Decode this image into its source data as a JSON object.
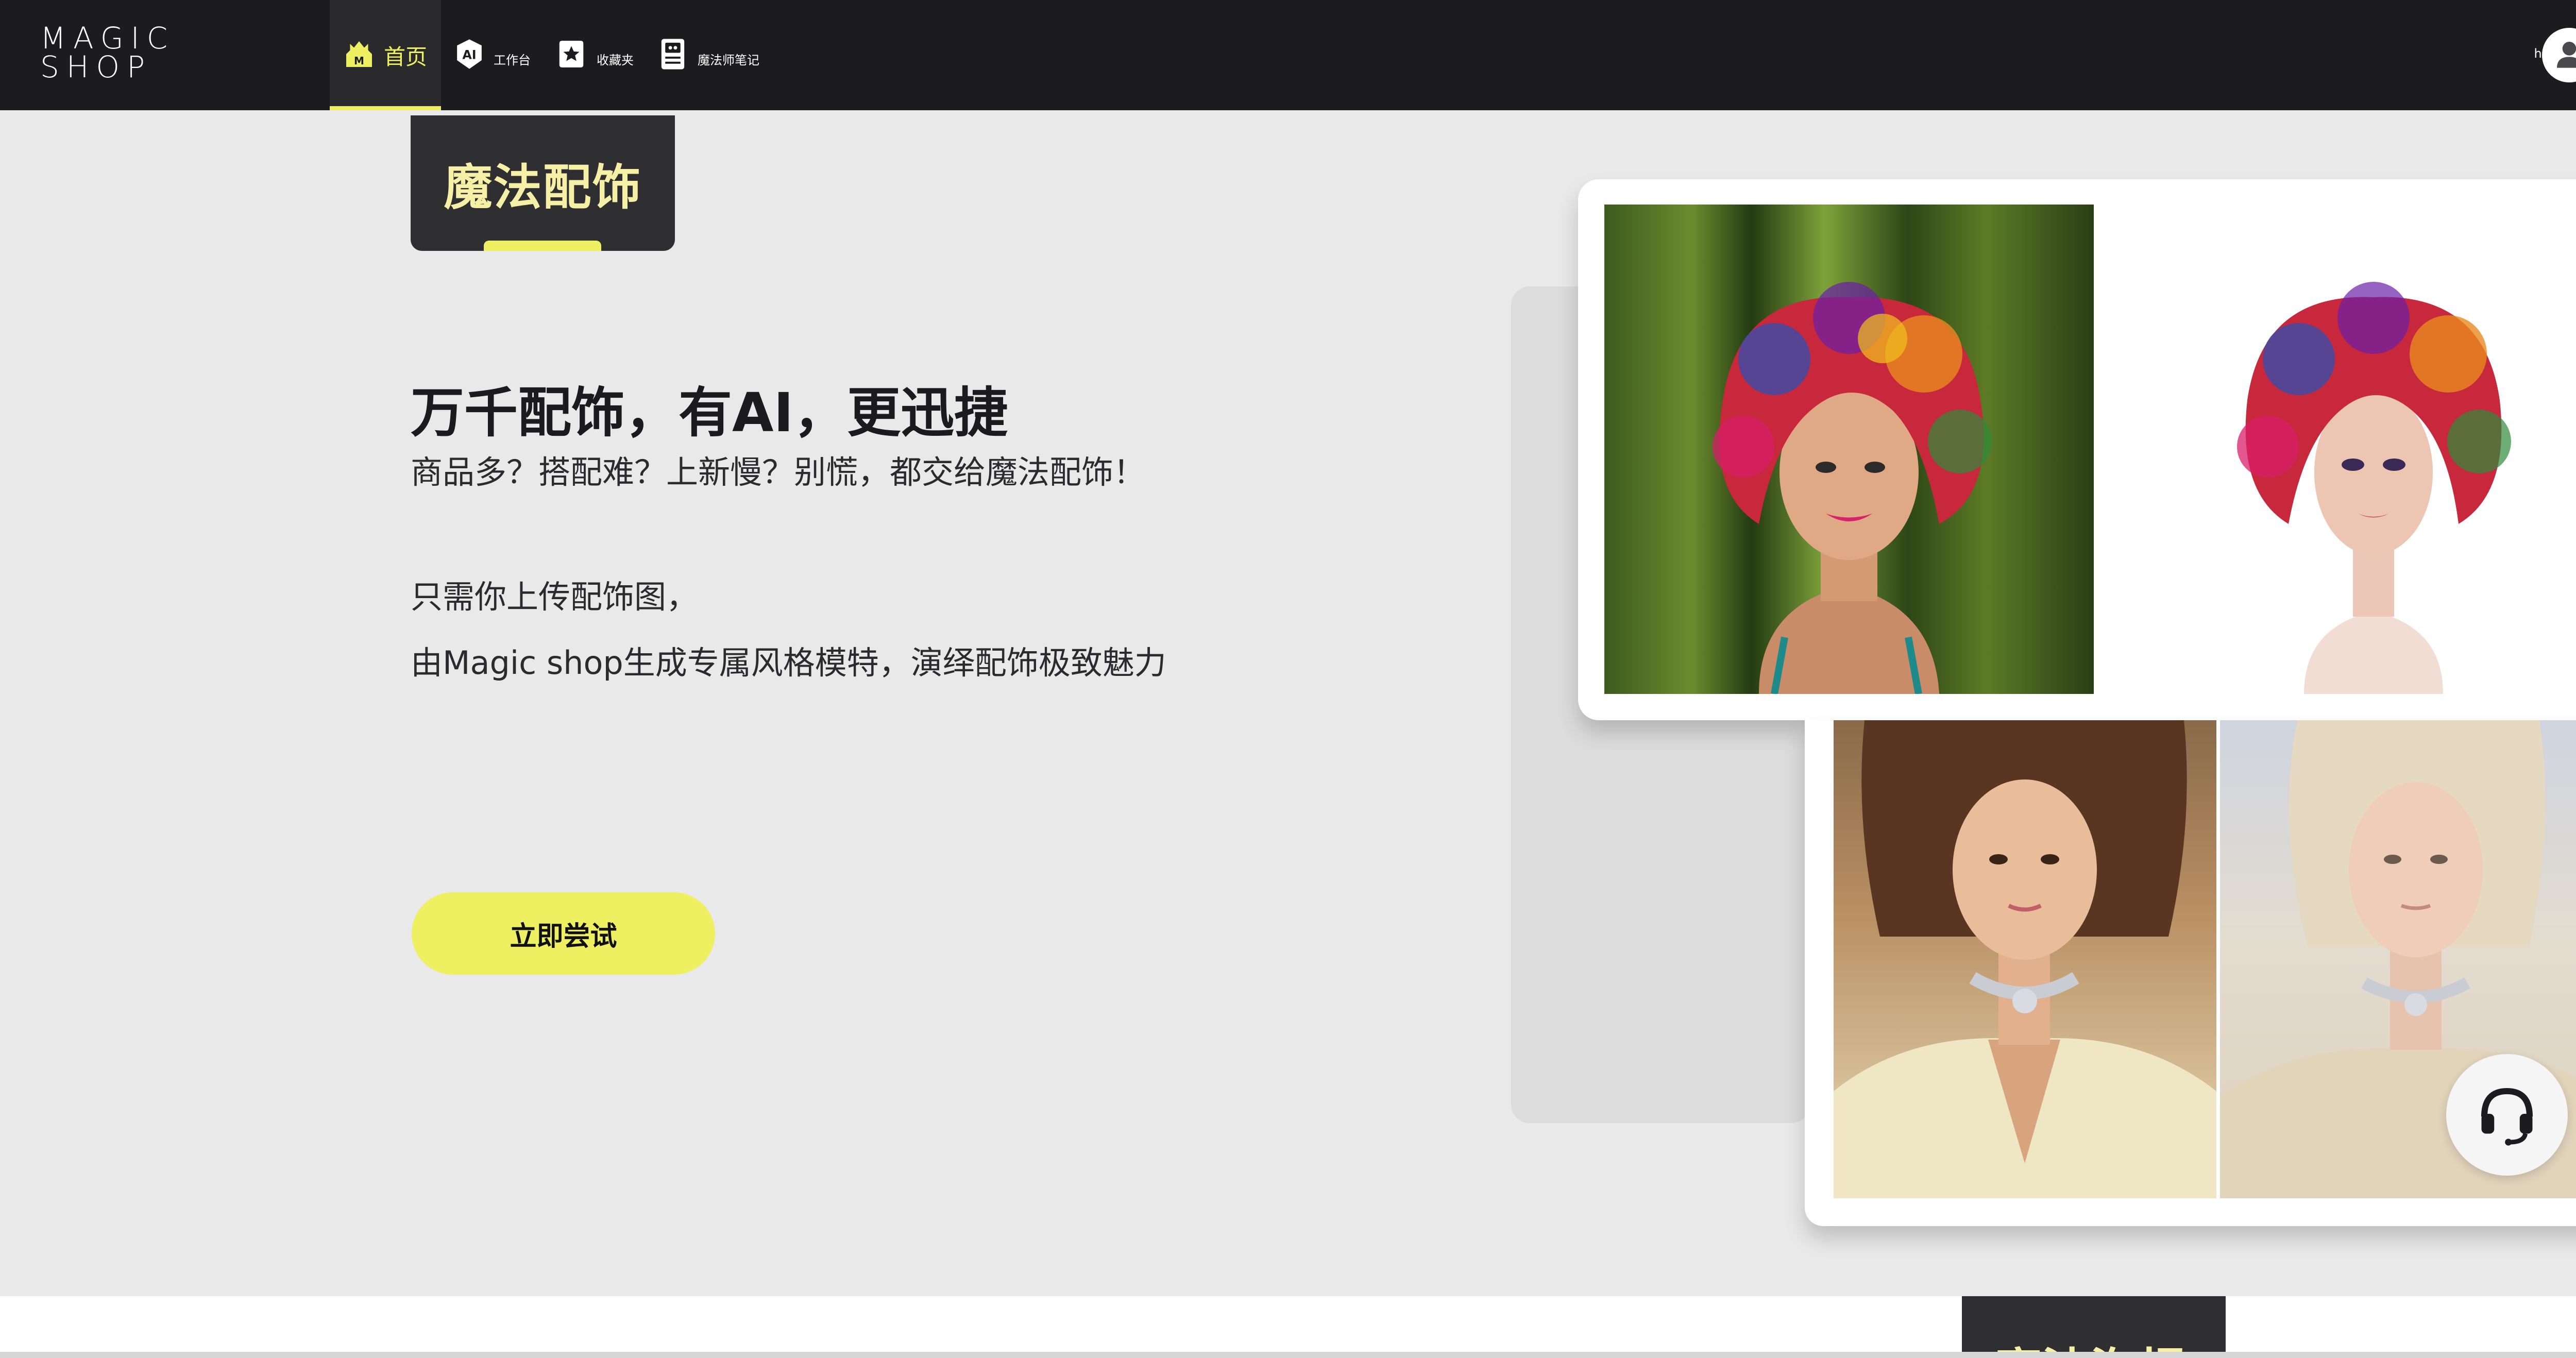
{
  "app": {
    "logo": "MAGIC SHOP"
  },
  "nav": {
    "items": [
      {
        "label": "首页",
        "icon": "castle-icon",
        "active": true
      },
      {
        "label": "工作台",
        "icon": "ai-icon",
        "active": false
      },
      {
        "label": "收藏夹",
        "icon": "star-icon",
        "active": false
      },
      {
        "label": "魔法师笔记",
        "icon": "notebook-icon",
        "active": false
      }
    ],
    "greeting": "hi,",
    "avatar_icon": "user-icon"
  },
  "hero": {
    "section_tag": "魔法配饰",
    "headline": "万千配饰，有AI，更迅捷",
    "subline": "商品多？搭配难？上新慢？别慌，都交给魔法配饰！",
    "desc_line1": "只需你上传配饰图，",
    "desc_line2": "由Magic shop生成专属风格模特，演绎配饰极致魅力",
    "cta_label": "立即尝试"
  },
  "next_section": {
    "section_tag": "魔法海报"
  },
  "colors": {
    "accent": "#eef061",
    "nav_bg": "#1c1c1e",
    "tag_bg": "#2f2f31",
    "tag_text": "#f6f0a6",
    "page_bg": "#e9e9e9"
  }
}
